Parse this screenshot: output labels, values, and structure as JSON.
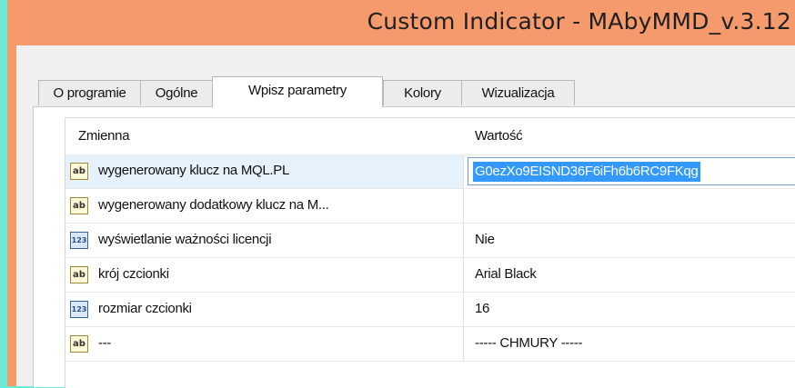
{
  "window": {
    "title": "Custom Indicator - MAbyMMD_v.3.12"
  },
  "tabs": [
    {
      "label": "O programie"
    },
    {
      "label": "Ogólne"
    },
    {
      "label": "Wpisz parametry"
    },
    {
      "label": "Kolory"
    },
    {
      "label": "Wizualizacja"
    }
  ],
  "active_tab": "Wpisz parametry",
  "grid": {
    "headers": {
      "name": "Zmienna",
      "value": "Wartość"
    },
    "rows": [
      {
        "icon": "ab-string-icon",
        "icon_text": "ab",
        "name": "wygenerowany klucz na MQL.PL",
        "value": "G0ezXo9EISND36F6iFh6b6RC9FKqg",
        "selected": true
      },
      {
        "icon": "ab-string-icon",
        "icon_text": "ab",
        "name": "wygenerowany dodatkowy klucz na M...",
        "value": ""
      },
      {
        "icon": "123-numeric-icon",
        "icon_text": "123",
        "name": "wyświetlanie ważności licencji",
        "value": "Nie"
      },
      {
        "icon": "ab-string-icon",
        "icon_text": "ab",
        "name": "krój czcionki",
        "value": "Arial Black"
      },
      {
        "icon": "123-numeric-icon",
        "icon_text": "123",
        "name": "rozmiar czcionki",
        "value": "16"
      },
      {
        "icon": "ab-string-icon",
        "icon_text": "ab",
        "name": "---",
        "value": "----- CHMURY -----"
      }
    ]
  }
}
